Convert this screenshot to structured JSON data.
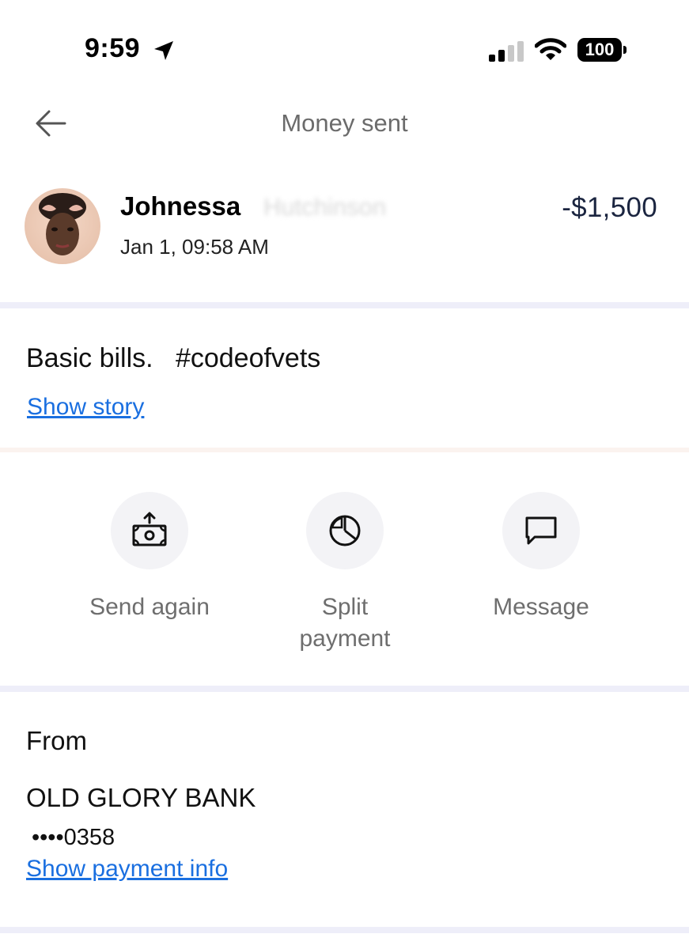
{
  "status_bar": {
    "time": "9:59",
    "battery": "100"
  },
  "header": {
    "title": "Money sent",
    "back_icon": "arrow-left-icon"
  },
  "recipient": {
    "name": "Johnessa",
    "name_redacted": "Hutchinson",
    "date": "Jan 1, 09:58 AM",
    "amount": "-$1,500"
  },
  "note": {
    "text": "Basic bills.   #codeofvets",
    "show_story_label": "Show story"
  },
  "actions": [
    {
      "label": "Send again",
      "icon": "send-money-icon"
    },
    {
      "label": "Split payment",
      "icon": "pie-chart-icon"
    },
    {
      "label": "Message",
      "icon": "chat-bubble-icon"
    }
  ],
  "from": {
    "label": "From",
    "bank": "OLD GLORY BANK",
    "account": "••••0358",
    "show_payment_label": "Show payment info"
  },
  "colors": {
    "link": "#1a6fe0",
    "amount": "#1b2540",
    "divider": "#eeeef9",
    "action_bg": "#f3f3f6"
  }
}
